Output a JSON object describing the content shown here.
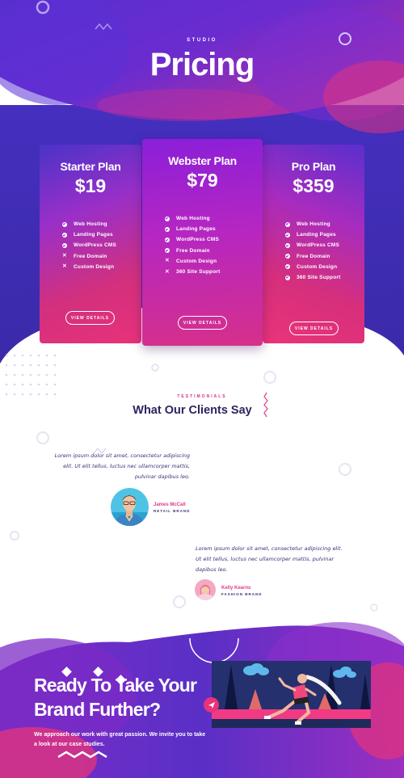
{
  "hero": {
    "eyebrow": "STUDIO",
    "title": "Pricing"
  },
  "plans": [
    {
      "name": "Starter Plan",
      "price": "$19",
      "button": "VIEW DETAILS",
      "features": [
        {
          "label": "Web Hosting",
          "included": true
        },
        {
          "label": "Landing Pages",
          "included": true
        },
        {
          "label": "WordPress CMS",
          "included": true
        },
        {
          "label": "Free Domain",
          "included": false
        },
        {
          "label": "Custom Design",
          "included": false
        }
      ]
    },
    {
      "name": "Webster Plan",
      "price": "$79",
      "button": "VIEW DETAILS",
      "features": [
        {
          "label": "Web Hosting",
          "included": true
        },
        {
          "label": "Landing Pages",
          "included": true
        },
        {
          "label": "WordPress CMS",
          "included": true
        },
        {
          "label": "Free Domain",
          "included": true
        },
        {
          "label": "Custom Design",
          "included": false
        },
        {
          "label": "360 Site Support",
          "included": false
        }
      ]
    },
    {
      "name": "Pro Plan",
      "price": "$359",
      "button": "VIEW DETAILS",
      "features": [
        {
          "label": "Web Hosting",
          "included": true
        },
        {
          "label": "Landing Pages",
          "included": true
        },
        {
          "label": "WordPress CMS",
          "included": true
        },
        {
          "label": "Free Domain",
          "included": true
        },
        {
          "label": "Custom Design",
          "included": true
        },
        {
          "label": "360 Site Support",
          "included": true
        }
      ]
    }
  ],
  "testimonials": {
    "eyebrow": "TESTIMONIALS",
    "title": "What Our Clients Say",
    "items": [
      {
        "quote": "Lorem ipsum dolor sit amet, consectetur adipiscing elit. Ut elit tellus, luctus nec ullamcorper mattis, pulvinar dapibus leo.",
        "name": "James McCall",
        "role": "RETAIL BRAND"
      },
      {
        "quote": "Lorem ipsum dolor sit amet, consectetur adipiscing elit. Ut elit tellus, luctus nec ullamcorper mattis, pulvinar dapibus leo.",
        "name": "Kelly Kearns",
        "role": "FASHION BRAND"
      }
    ]
  },
  "cta": {
    "title": "Ready To Take Your Brand Further?",
    "text": "We approach our work with great passion. We invite you to take a look at our case studies."
  },
  "colors": {
    "purple": "#4b2fd0",
    "magenta": "#e8327a",
    "navy": "#2b2560",
    "pink_text": "#e03a8c"
  },
  "icons": {
    "included": "check-circle-icon",
    "excluded": "x-icon",
    "cta_badge": "paper-plane-icon"
  }
}
